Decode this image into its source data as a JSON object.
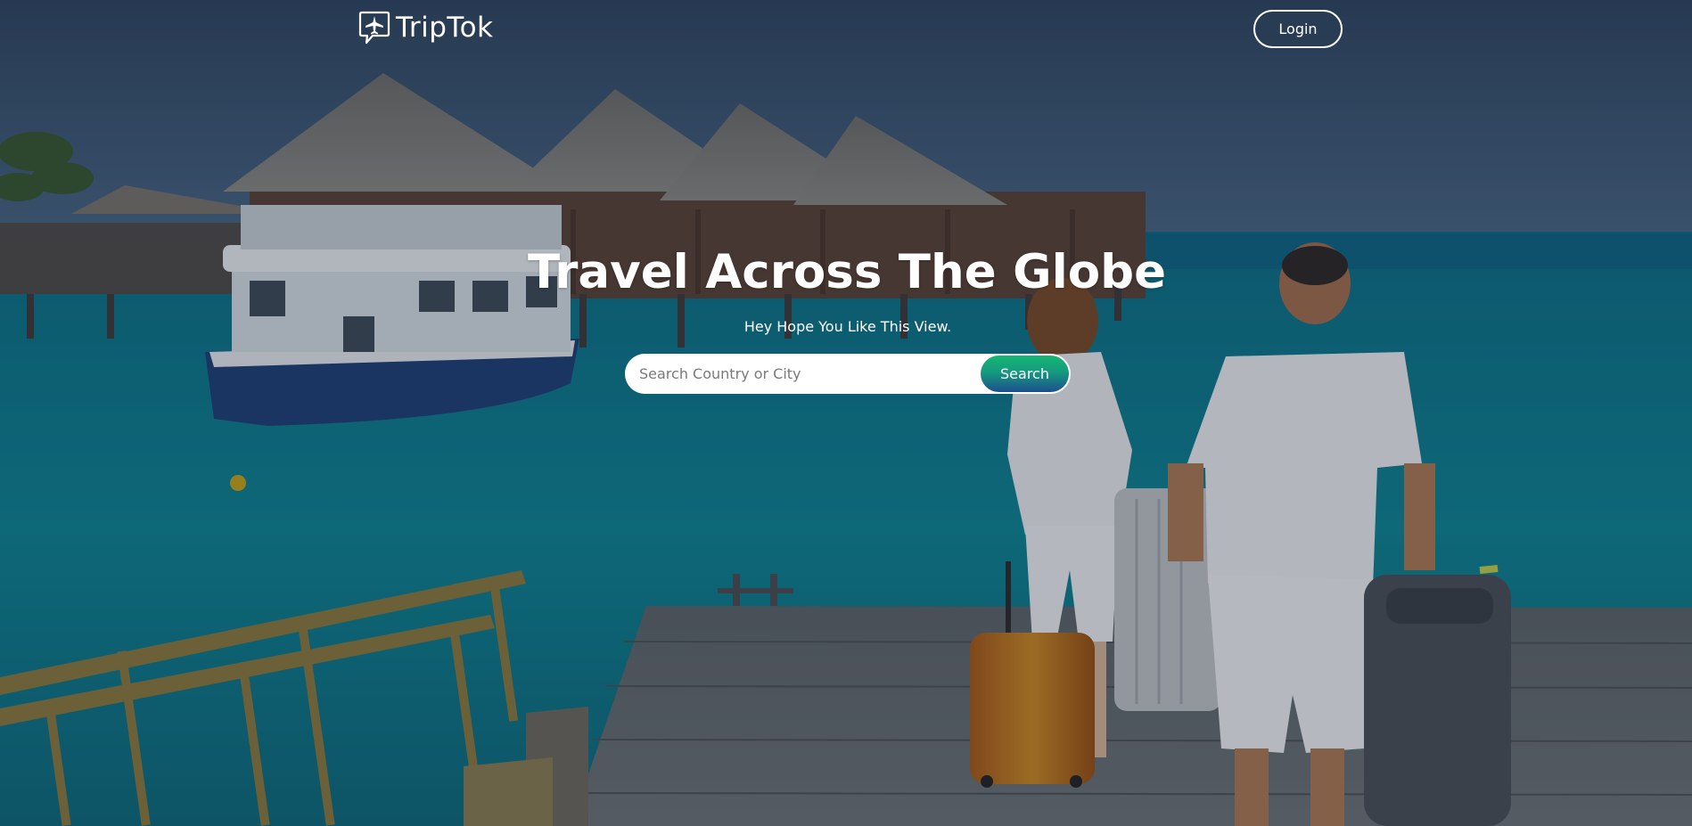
{
  "brand": {
    "name": "TripTok",
    "icon": "airplane-chat-bubble-icon"
  },
  "header": {
    "login_label": "Login"
  },
  "hero": {
    "title": "Travel Across The Globe",
    "subtitle": "Hey Hope You Like This View.",
    "background_scene": "tropical-resort-pier-photo"
  },
  "search": {
    "placeholder": "Search Country or City",
    "value": "",
    "button_label": "Search"
  },
  "colors": {
    "search_button_top": "#15b872",
    "search_button_bottom": "#1d4f8e",
    "text": "#ffffff",
    "sea": "#0c7f8f",
    "sky": "#3a5678"
  }
}
